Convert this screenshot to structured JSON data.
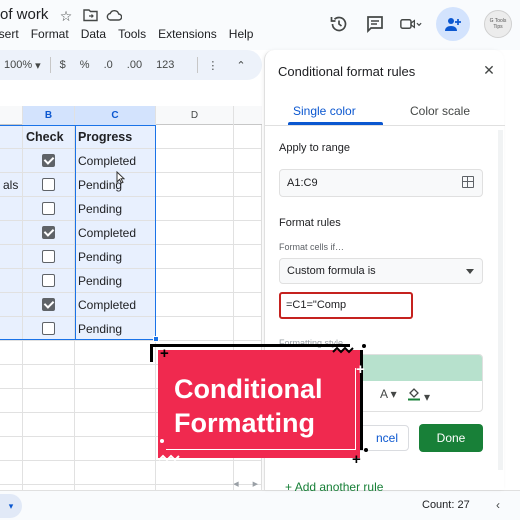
{
  "window": {
    "doc_title": "of work",
    "menu": [
      "nsert",
      "Format",
      "Data",
      "Tools",
      "Extensions",
      "Help"
    ],
    "avatar_text": "G Tools Tips"
  },
  "toolbar": {
    "zoom": "100%",
    "currency": "$",
    "percent": "%",
    "decrease_decimal": ".0",
    "increase_decimal": ".00",
    "number_format": "123"
  },
  "grid": {
    "columns": [
      {
        "label": "B",
        "selected": true
      },
      {
        "label": "C",
        "selected": true
      },
      {
        "label": "D",
        "selected": false
      }
    ],
    "header_row": {
      "check": "Check",
      "progress": "Progress"
    },
    "rows": [
      {
        "a": "",
        "checked": true,
        "progress": "Completed"
      },
      {
        "a": "als",
        "checked": false,
        "progress": "Pending"
      },
      {
        "a": "",
        "checked": false,
        "progress": "Pending"
      },
      {
        "a": "",
        "checked": true,
        "progress": "Completed"
      },
      {
        "a": "",
        "checked": false,
        "progress": "Pending"
      },
      {
        "a": "",
        "checked": false,
        "progress": "Pending"
      },
      {
        "a": "",
        "checked": true,
        "progress": "Completed"
      },
      {
        "a": "",
        "checked": false,
        "progress": "Pending"
      }
    ]
  },
  "status": {
    "count": "Count: 27"
  },
  "panel": {
    "title": "Conditional format rules",
    "tabs": [
      "Single color",
      "Color scale"
    ],
    "apply_label": "Apply to range",
    "range": "A1:C9",
    "format_rules_label": "Format rules",
    "format_cells_if": "Format cells if…",
    "condition": "Custom formula is",
    "formula": "=C1=\"Comp",
    "formatting_style_label": "Formatting style",
    "cancel_label": "ncel",
    "done_label": "Done",
    "add_rule_label": "Add another rule",
    "preview_color": "#b7e1cd"
  },
  "overlay": {
    "line1": "Conditional",
    "line2": "Formatting",
    "card_color": "#f0294f"
  },
  "colors": {
    "accent": "#0b57d0",
    "selection": "#1a73e8",
    "done": "#188038",
    "formula_border": "#c5221f"
  }
}
